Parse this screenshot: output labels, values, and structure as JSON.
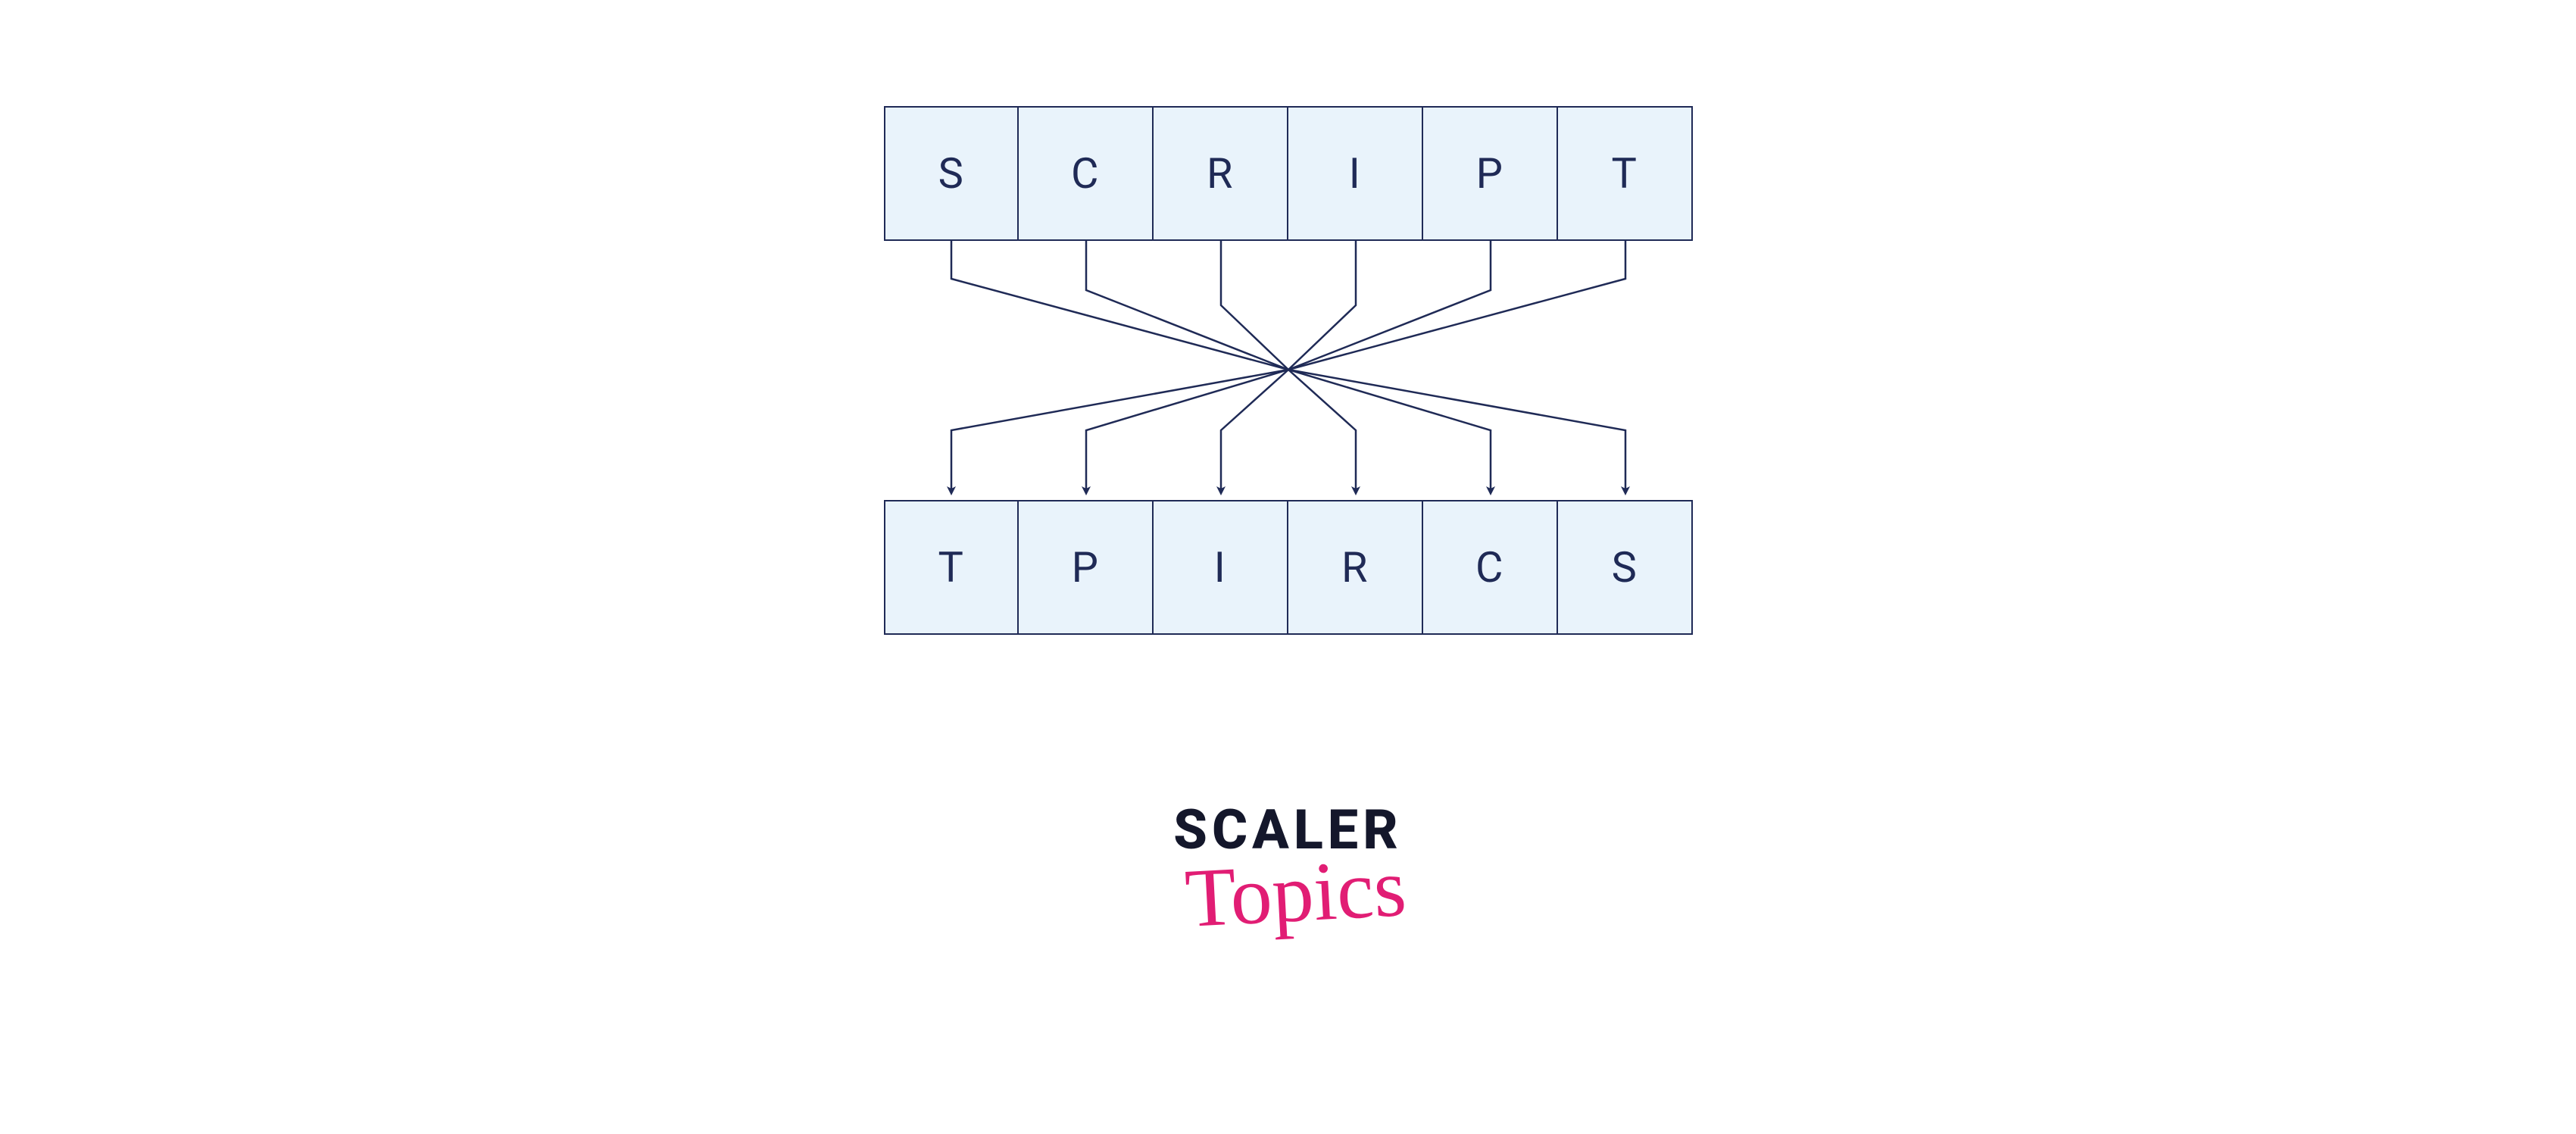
{
  "diagram": {
    "top_row": [
      "S",
      "C",
      "R",
      "I",
      "P",
      "T"
    ],
    "bottom_row": [
      "T",
      "P",
      "I",
      "R",
      "C",
      "S"
    ],
    "mapping": [
      {
        "from": 0,
        "to": 5
      },
      {
        "from": 1,
        "to": 4
      },
      {
        "from": 2,
        "to": 3
      },
      {
        "from": 3,
        "to": 2
      },
      {
        "from": 4,
        "to": 1
      },
      {
        "from": 5,
        "to": 0
      }
    ]
  },
  "colors": {
    "cell_fill": "#e9f3fb",
    "cell_border": "#1f2a56",
    "arrow": "#1f2a56",
    "logo_main": "#14172b",
    "logo_accent": "#e11d74"
  },
  "brand": {
    "line1": "SCALER",
    "line2": "Topics"
  }
}
